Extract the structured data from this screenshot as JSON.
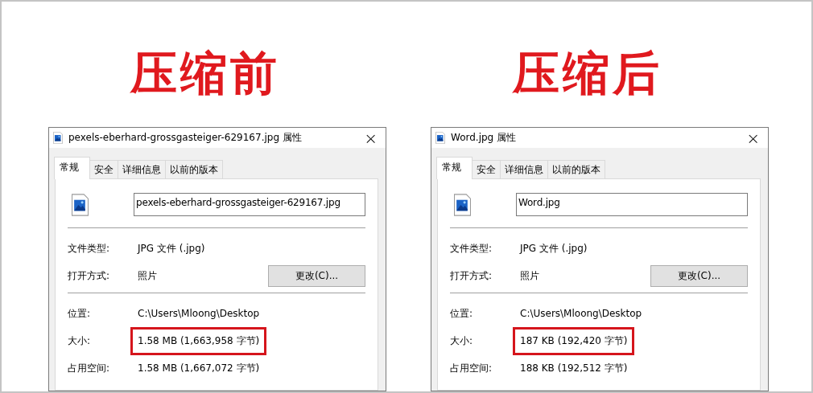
{
  "panels": [
    {
      "heading": "压缩前",
      "dialog": {
        "title": "pexels-eberhard-grossgasteiger-629167.jpg 属性",
        "close": "×",
        "tabs": [
          {
            "label": "常规",
            "selected": true
          },
          {
            "label": "安全",
            "selected": false
          },
          {
            "label": "详细信息",
            "selected": false
          },
          {
            "label": "以前的版本",
            "selected": false
          }
        ],
        "file_name": "pexels-eberhard-grossgasteiger-629167.jpg",
        "sections": [
          [
            {
              "label": "文件类型:",
              "value": "JPG 文件 (.jpg)",
              "highlighted": false
            },
            {
              "label": "打开方式:",
              "value": "照片",
              "button": "更改(C)...",
              "highlighted": false
            }
          ],
          [
            {
              "label": "位置:",
              "value": "C:\\Users\\Mloong\\Desktop",
              "highlighted": false
            },
            {
              "label": "大小:",
              "value": "1.58 MB (1,663,958 字节)",
              "highlighted": true
            },
            {
              "label": "占用空间:",
              "value": "1.58 MB (1,667,072 字节)",
              "highlighted": false
            }
          ]
        ]
      }
    },
    {
      "heading": "压缩后",
      "dialog": {
        "title": "Word.jpg 属性",
        "close": "×",
        "tabs": [
          {
            "label": "常规",
            "selected": true
          },
          {
            "label": "安全",
            "selected": false
          },
          {
            "label": "详细信息",
            "selected": false
          },
          {
            "label": "以前的版本",
            "selected": false
          }
        ],
        "file_name": "Word.jpg",
        "sections": [
          [
            {
              "label": "文件类型:",
              "value": "JPG 文件 (.jpg)",
              "highlighted": false
            },
            {
              "label": "打开方式:",
              "value": "照片",
              "button": "更改(C)...",
              "highlighted": false
            }
          ],
          [
            {
              "label": "位置:",
              "value": "C:\\Users\\Mloong\\Desktop",
              "highlighted": false
            },
            {
              "label": "大小:",
              "value": "187 KB (192,420 字节)",
              "highlighted": true
            },
            {
              "label": "占用空间:",
              "value": "188 KB (192,512 字节)",
              "highlighted": false
            }
          ]
        ]
      }
    }
  ]
}
